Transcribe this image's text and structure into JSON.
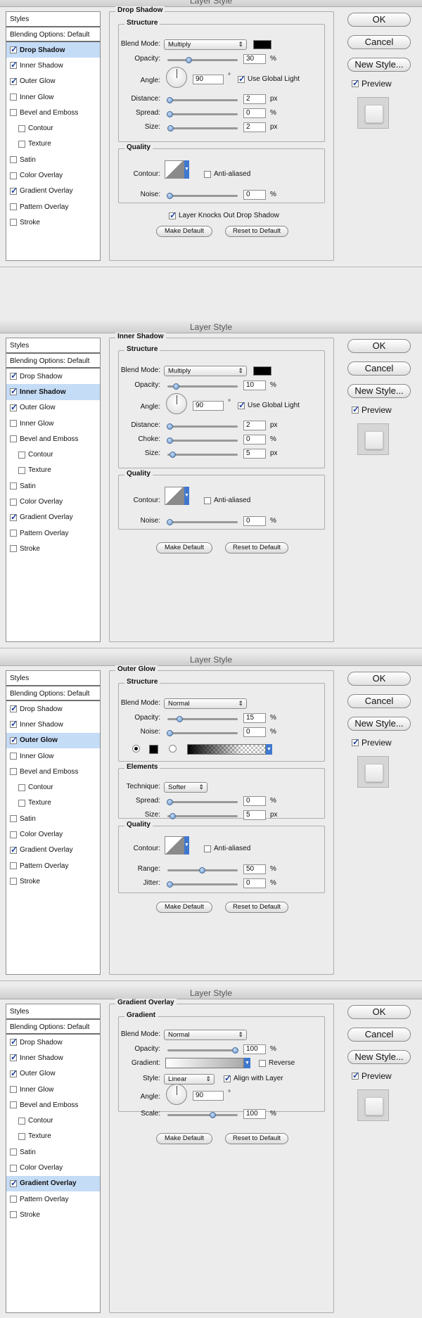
{
  "window_title": "Layer Style",
  "styles_panel": {
    "header": "Styles",
    "blending_options": "Blending Options: Default",
    "items": [
      {
        "label": "Drop Shadow",
        "checked": true
      },
      {
        "label": "Inner Shadow",
        "checked": true
      },
      {
        "label": "Outer Glow",
        "checked": true
      },
      {
        "label": "Inner Glow",
        "checked": false
      },
      {
        "label": "Bevel and Emboss",
        "checked": false
      },
      {
        "label": "Contour",
        "checked": false
      },
      {
        "label": "Texture",
        "checked": false
      },
      {
        "label": "Satin",
        "checked": false
      },
      {
        "label": "Color Overlay",
        "checked": false
      },
      {
        "label": "Gradient Overlay",
        "checked": true
      },
      {
        "label": "Pattern Overlay",
        "checked": false
      },
      {
        "label": "Stroke",
        "checked": false
      }
    ]
  },
  "side_buttons": {
    "ok": "OK",
    "cancel": "Cancel",
    "new_style": "New Style...",
    "preview": "Preview"
  },
  "common": {
    "make_default": "Make Default",
    "reset_default": "Reset to Default",
    "structure": "Structure",
    "quality": "Quality",
    "blend_mode": "Blend Mode:",
    "opacity": "Opacity:",
    "angle": "Angle:",
    "use_global_light": "Use Global Light",
    "distance": "Distance:",
    "spread": "Spread:",
    "size": "Size:",
    "contour": "Contour:",
    "anti_aliased": "Anti-aliased",
    "noise": "Noise:",
    "px": "px",
    "pct": "%",
    "deg": "°"
  },
  "drop_shadow": {
    "title": "Drop Shadow",
    "blend_mode": "Multiply",
    "opacity": "30",
    "angle": "90",
    "distance": "2",
    "spread": "0",
    "size": "2",
    "noise": "0",
    "knocks_out": "Layer Knocks Out Drop Shadow"
  },
  "inner_shadow": {
    "title": "Inner Shadow",
    "blend_mode": "Multiply",
    "opacity": "10",
    "angle": "90",
    "distance": "2",
    "choke_label": "Choke:",
    "choke": "0",
    "size": "5",
    "noise": "0"
  },
  "outer_glow": {
    "title": "Outer Glow",
    "blend_mode": "Normal",
    "opacity": "15",
    "noise": "0",
    "elements": "Elements",
    "technique_label": "Technique:",
    "technique": "Softer",
    "spread": "0",
    "size": "5",
    "range_label": "Range:",
    "range": "50",
    "jitter_label": "Jitter:",
    "jitter": "0"
  },
  "gradient_overlay": {
    "title": "Gradient Overlay",
    "section": "Gradient",
    "blend_mode": "Normal",
    "opacity": "100",
    "gradient_label": "Gradient:",
    "reverse": "Reverse",
    "style_label": "Style:",
    "style": "Linear",
    "align": "Align with Layer",
    "angle": "90",
    "scale_label": "Scale:",
    "scale": "100"
  }
}
